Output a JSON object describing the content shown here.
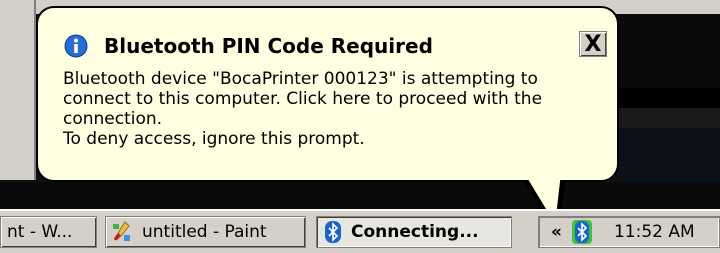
{
  "balloon": {
    "title": "Bluetooth PIN Code Required",
    "close_label": "X",
    "lines": [
      "Bluetooth device \"BocaPrinter 000123\" is attempting to",
      "connect to this computer.  Click here to proceed with the",
      "connection.",
      "To deny access, ignore this prompt."
    ]
  },
  "taskbar": {
    "buttons": [
      {
        "label": "nt - W...",
        "icon": "notepad-icon"
      },
      {
        "label": "untitled - Paint",
        "icon": "paint-icon"
      },
      {
        "label": "Connecting...",
        "icon": "bluetooth-icon"
      }
    ],
    "tray": {
      "chevron": "«",
      "icon": "bluetooth-icon",
      "time": "11:52 AM"
    }
  },
  "colors": {
    "balloon_bg": "#ffffe1",
    "taskbar_bg": "#d4d0c8",
    "bluetooth_blue": "#1e64c8",
    "info_blue": "#2a6cd6"
  }
}
